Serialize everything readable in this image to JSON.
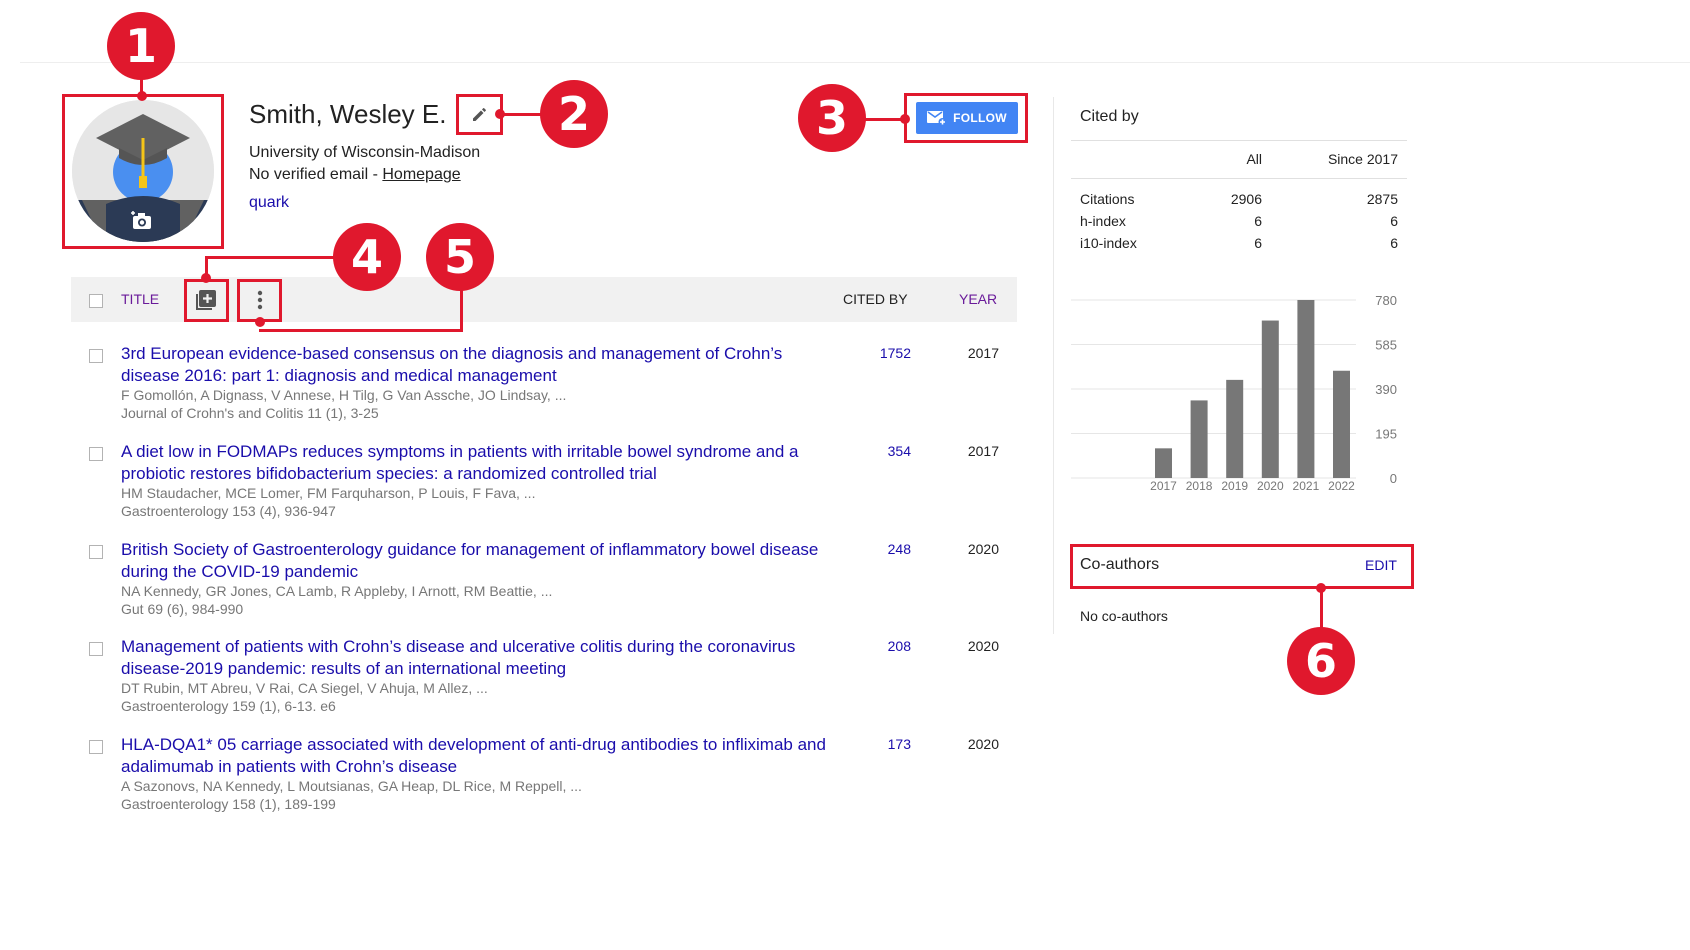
{
  "profile": {
    "name": "Smith, Wesley E.",
    "affiliation": "University of Wisconsin-Madison",
    "email_text": "No verified email - ",
    "homepage_label": "Homepage",
    "interest": "quark",
    "avatar_icon": "graduation-cap-avatar-icon",
    "camera_icon": "add-photo-camera-icon",
    "edit_icon": "pencil-icon",
    "follow_label": "FOLLOW",
    "follow_icon": "mail-plus-icon"
  },
  "table": {
    "header": {
      "title": "TITLE",
      "cited_by": "CITED BY",
      "year": "YEAR"
    },
    "add_icon": "add-box-icon",
    "more_icon": "more-vertical-icon",
    "rows": [
      {
        "title": "3rd European evidence-based consensus on the diagnosis and management of Crohn’s disease 2016: part 1: diagnosis and medical management",
        "authors": "F Gomollón, A Dignass, V Annese, H Tilg, G Van Assche, JO Lindsay, ...",
        "venue": "Journal of Crohn's and Colitis 11 (1), 3-25",
        "cited_by": "1752",
        "year": "2017"
      },
      {
        "title": "A diet low in FODMAPs reduces symptoms in patients with irritable bowel syndrome and a probiotic restores bifidobacterium species: a randomized controlled trial",
        "authors": "HM Staudacher, MCE Lomer, FM Farquharson, P Louis, F Fava, ...",
        "venue": "Gastroenterology 153 (4), 936-947",
        "cited_by": "354",
        "year": "2017"
      },
      {
        "title": "British Society of Gastroenterology guidance for management of inflammatory bowel disease during the COVID-19 pandemic",
        "authors": "NA Kennedy, GR Jones, CA Lamb, R Appleby, I Arnott, RM Beattie, ...",
        "venue": "Gut 69 (6), 984-990",
        "cited_by": "248",
        "year": "2020"
      },
      {
        "title": "Management of patients with Crohn’s disease and ulcerative colitis during the coronavirus disease-2019 pandemic: results of an international meeting",
        "authors": "DT Rubin, MT Abreu, V Rai, CA Siegel, V Ahuja, M Allez, ...",
        "venue": "Gastroenterology 159 (1), 6-13. e6",
        "cited_by": "208",
        "year": "2020"
      },
      {
        "title": "HLA-DQA1* 05 carriage associated with development of anti-drug antibodies to infliximab and adalimumab in patients with Crohn’s disease",
        "authors": "A Sazonovs, NA Kennedy, L Moutsianas, GA Heap, DL Rice, M Reppell, ...",
        "venue": "Gastroenterology 158 (1), 189-199",
        "cited_by": "173",
        "year": "2020"
      }
    ]
  },
  "cited_by": {
    "heading": "Cited by",
    "col_all": "All",
    "col_since": "Since 2017",
    "rows": [
      {
        "label": "Citations",
        "all": "2906",
        "since": "2875"
      },
      {
        "label": "h-index",
        "all": "6",
        "since": "6"
      },
      {
        "label": "i10-index",
        "all": "6",
        "since": "6"
      }
    ]
  },
  "chart_data": {
    "type": "bar",
    "categories": [
      "2017",
      "2018",
      "2019",
      "2020",
      "2021",
      "2022"
    ],
    "values": [
      130,
      340,
      430,
      690,
      780,
      470
    ],
    "yticks": [
      0,
      195,
      390,
      585,
      780
    ],
    "ylim": [
      0,
      780
    ],
    "grid": true,
    "bar_color": "#777777"
  },
  "coauthors": {
    "title": "Co-authors",
    "edit_label": "EDIT",
    "empty_text": "No co-authors"
  },
  "annotations": {
    "color": "#e0182d",
    "badges": [
      "1",
      "2",
      "3",
      "4",
      "5",
      "6"
    ]
  }
}
